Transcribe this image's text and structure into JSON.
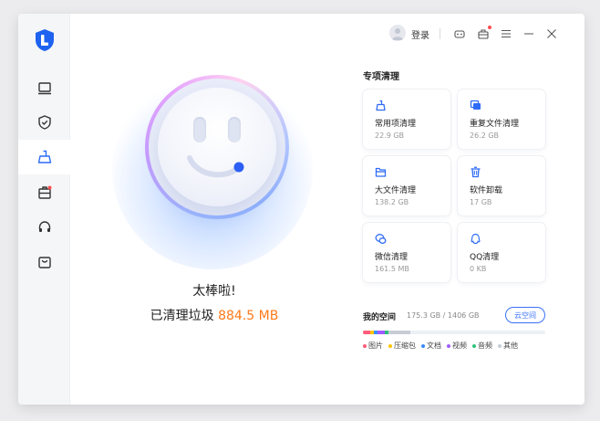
{
  "titlebar": {
    "login_label": "登录",
    "icons": [
      "avatar-icon",
      "robot-icon",
      "gift-icon",
      "menu-icon",
      "minimize-icon",
      "close-icon"
    ]
  },
  "sidebar": {
    "items": [
      {
        "icon": "monitor-icon"
      },
      {
        "icon": "shield-check-icon"
      },
      {
        "icon": "broom-icon",
        "active": true
      },
      {
        "icon": "toolbox-icon"
      },
      {
        "icon": "headset-icon"
      },
      {
        "icon": "bag-icon"
      }
    ]
  },
  "main": {
    "great_text": "太棒啦!",
    "cleaned_prefix": "已清理垃圾 ",
    "cleaned_value": "884.5 MB"
  },
  "special": {
    "title": "专项清理",
    "cards": [
      {
        "label": "常用项清理",
        "size": "22.9 GB",
        "icon": "broom-icon"
      },
      {
        "label": "重复文件清理",
        "size": "26.2 GB",
        "icon": "duplicate-files-icon"
      },
      {
        "label": "大文件清理",
        "size": "138.2 GB",
        "icon": "folder-icon"
      },
      {
        "label": "软件卸载",
        "size": "17 GB",
        "icon": "trash-icon"
      },
      {
        "label": "微信清理",
        "size": "161.5 MB",
        "icon": "wechat-icon"
      },
      {
        "label": "QQ清理",
        "size": "0 KB",
        "icon": "qq-icon"
      }
    ]
  },
  "space": {
    "title": "我的空间",
    "usage": "175.3 GB / 1406 GB",
    "cloud_button": "云空间",
    "segments": [
      {
        "name": "图片",
        "color": "#ff5b7a",
        "fraction": 0.04
      },
      {
        "name": "压缩包",
        "color": "#ffc400",
        "fraction": 0.02
      },
      {
        "name": "文档",
        "color": "#3a8dff",
        "fraction": 0.02
      },
      {
        "name": "视频",
        "color": "#a05cff",
        "fraction": 0.04
      },
      {
        "name": "音频",
        "color": "#2fc27a",
        "fraction": 0.02
      },
      {
        "name": "其他",
        "color": "#c7ccd6",
        "fraction": 0.12
      }
    ],
    "legend": [
      "图片",
      "压缩包",
      "文档",
      "视频",
      "音频",
      "其他"
    ]
  },
  "colors": {
    "accent": "#3a72f6",
    "cleaned_value": "#ff7a1a"
  }
}
